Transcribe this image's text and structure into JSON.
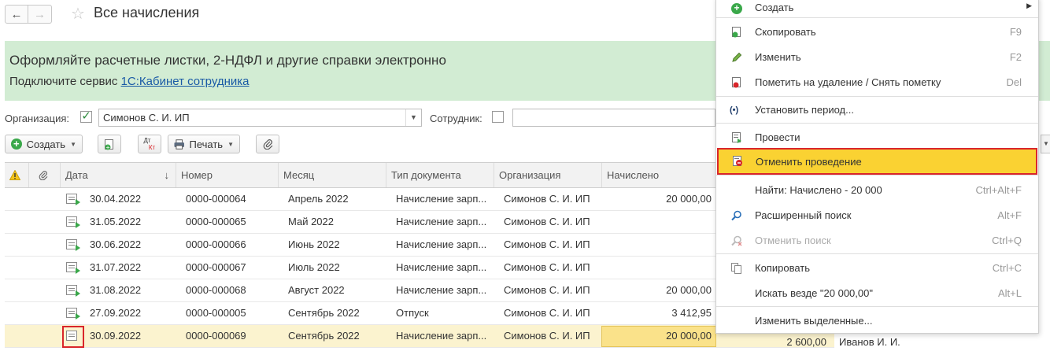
{
  "window": {
    "title": "Все начисления"
  },
  "banner": {
    "main": "Оформляйте расчетные листки, 2-НДФЛ и другие справки электронно",
    "sub_prefix": "Подключите сервис ",
    "link": "1С:Кабинет сотрудника"
  },
  "filters": {
    "org_label": "Организация:",
    "org_value": "Симонов С. И. ИП",
    "employee_label": "Сотрудник:",
    "employee_value": ""
  },
  "toolbar": {
    "create": "Создать",
    "print": "Печать",
    "dtkt_top": "Дт",
    "dtkt_bottom": "Кт"
  },
  "table": {
    "columns": [
      "Дата",
      "Номер",
      "Месяц",
      "Тип документа",
      "Организация",
      "Начислено"
    ],
    "sort_indicator": "↓",
    "rows": [
      {
        "date": "30.04.2022",
        "number": "0000-000064",
        "month": "Апрель 2022",
        "type": "Начисление зарп...",
        "org": "Симонов С. И. ИП",
        "amount": "20 000,00",
        "posted": true
      },
      {
        "date": "31.05.2022",
        "number": "0000-000065",
        "month": "Май 2022",
        "type": "Начисление зарп...",
        "org": "Симонов С. И. ИП",
        "amount": "",
        "posted": true
      },
      {
        "date": "30.06.2022",
        "number": "0000-000066",
        "month": "Июнь 2022",
        "type": "Начисление зарп...",
        "org": "Симонов С. И. ИП",
        "amount": "",
        "posted": true
      },
      {
        "date": "31.07.2022",
        "number": "0000-000067",
        "month": "Июль 2022",
        "type": "Начисление зарп...",
        "org": "Симонов С. И. ИП",
        "amount": "",
        "posted": true
      },
      {
        "date": "31.08.2022",
        "number": "0000-000068",
        "month": "Август 2022",
        "type": "Начисление зарп...",
        "org": "Симонов С. И. ИП",
        "amount": "20 000,00",
        "posted": true
      },
      {
        "date": "27.09.2022",
        "number": "0000-000005",
        "month": "Сентябрь 2022",
        "type": "Отпуск",
        "org": "Симонов С. И. ИП",
        "amount": "3 412,95",
        "posted": true
      },
      {
        "date": "30.09.2022",
        "number": "0000-000069",
        "month": "Сентябрь 2022",
        "type": "Начисление зарп...",
        "org": "Симонов С. И. ИП",
        "amount": "20 000,00",
        "posted": false,
        "extra_amount": "2 600,00",
        "extra_name": "Иванов И. И."
      }
    ]
  },
  "menu": {
    "items": [
      {
        "label": "Создать",
        "key": ""
      },
      {
        "label": "Скопировать",
        "key": "F9"
      },
      {
        "label": "Изменить",
        "key": "F2"
      },
      {
        "label": "Пометить на удаление / Снять пометку",
        "key": "Del"
      },
      {
        "label": "Установить период...",
        "key": ""
      },
      {
        "label": "Провести",
        "key": ""
      },
      {
        "label": "Отменить проведение",
        "key": ""
      },
      {
        "label": "Найти: Начислено - 20 000",
        "key": "Ctrl+Alt+F"
      },
      {
        "label": "Расширенный поиск",
        "key": "Alt+F"
      },
      {
        "label": "Отменить поиск",
        "key": "Ctrl+Q"
      },
      {
        "label": "Копировать",
        "key": "Ctrl+C"
      },
      {
        "label": "Искать везде \"20 000,00\"",
        "key": "Alt+L"
      },
      {
        "label": "Изменить выделенные...",
        "key": ""
      }
    ]
  },
  "colors": {
    "banner_bg": "#d2ecd3",
    "highlight": "#fad232",
    "frame_red": "#d9262b",
    "link": "#1a5aa6"
  }
}
